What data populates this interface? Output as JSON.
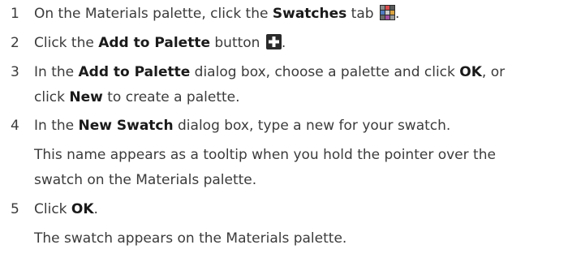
{
  "steps": [
    {
      "number": "1",
      "pre": "On the Materials palette, click the ",
      "bold": "Swatches",
      "post": " tab",
      "end": ".",
      "icon": "swatches-tab-icon"
    },
    {
      "number": "2",
      "pre": "Click the ",
      "bold": "Add to Palette",
      "post": " button",
      "end": ".",
      "icon": "add-to-palette-icon"
    },
    {
      "number": "3",
      "line1_pre": "In the ",
      "line1_bold1": "Add to Palette",
      "line1_mid": " dialog box, choose a palette and click ",
      "line1_bold2": "OK",
      "line1_post": ", or",
      "line2_pre": "click ",
      "line2_bold": "New",
      "line2_post": " to create a palette."
    },
    {
      "number": "4",
      "pre": "In the ",
      "bold": "New Swatch",
      "post": " dialog box, type a new for your swatch.",
      "note_line1": "This name appears as a tooltip when you hold the pointer over the",
      "note_line2": "swatch on the Materials palette."
    },
    {
      "number": "5",
      "pre": "Click ",
      "bold": "OK",
      "post": ".",
      "note": "The swatch appears on the Materials palette."
    }
  ],
  "colors": {
    "text": "#3b3b3b",
    "bold_text": "#1a1a1a",
    "icon_dark": "#2b2b2b"
  }
}
